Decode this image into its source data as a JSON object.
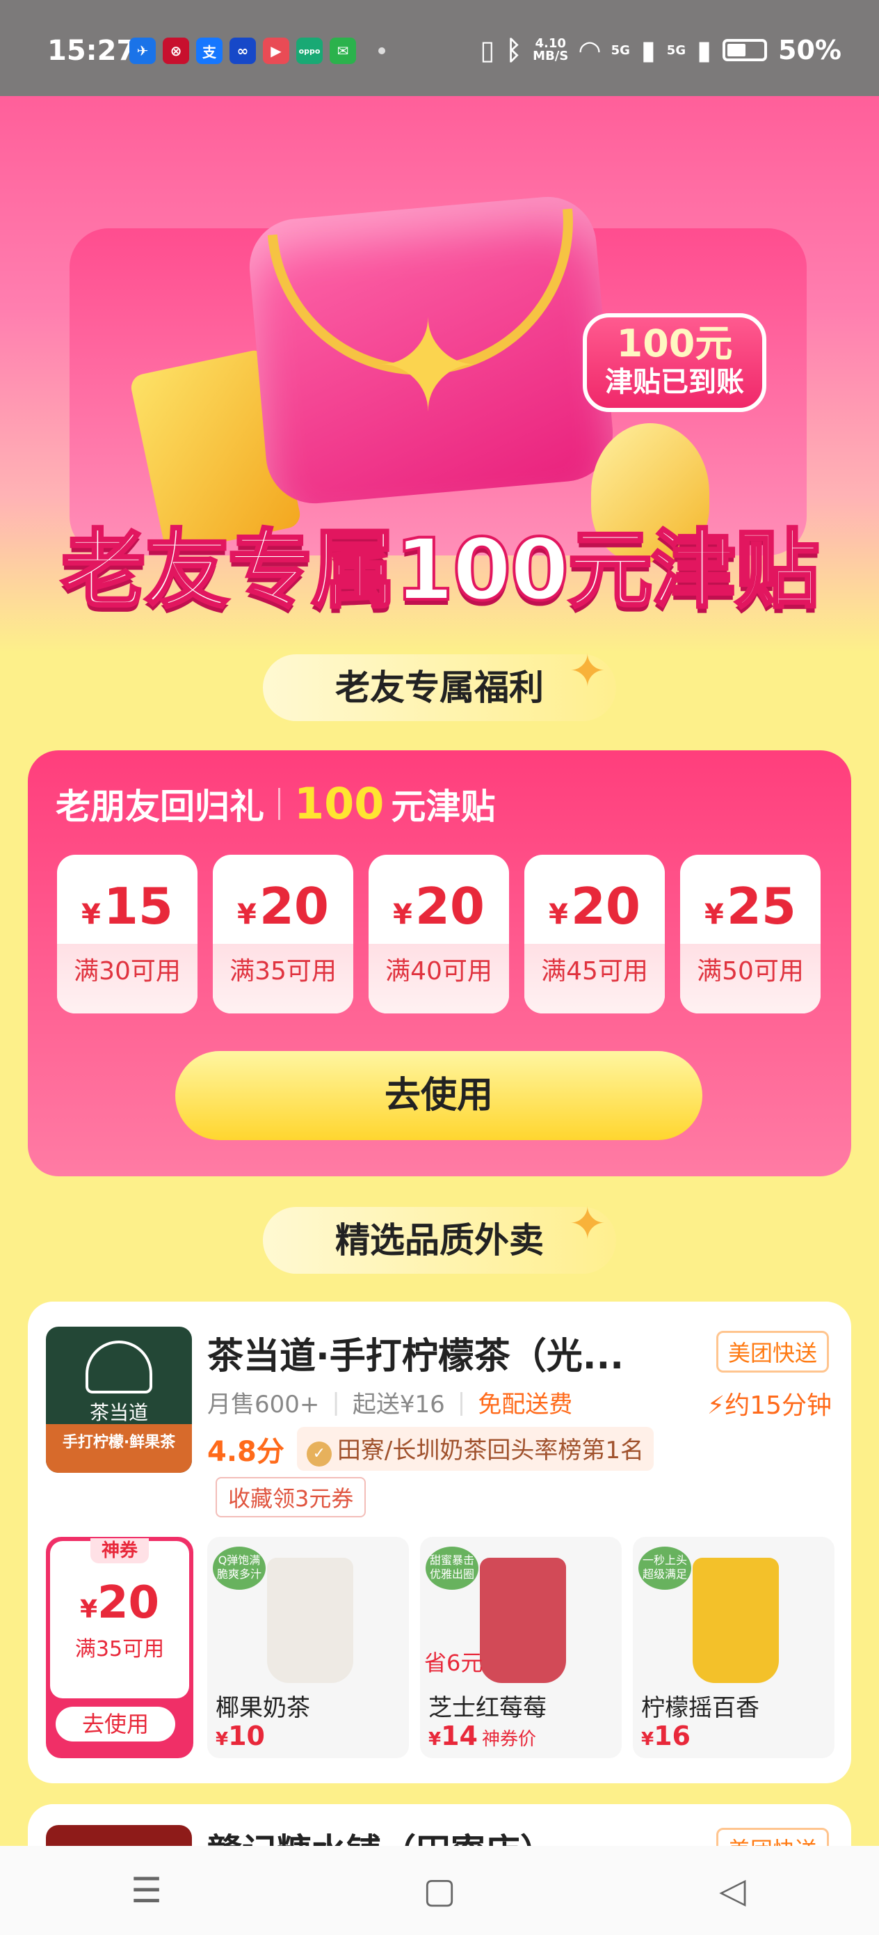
{
  "status_bar": {
    "time": "15:27",
    "apps": [
      {
        "icon": "bird-app-icon",
        "glyph": "✈",
        "color": "#1a73e8"
      },
      {
        "icon": "bank-app-icon",
        "glyph": "⊗",
        "color": "#c8102e"
      },
      {
        "icon": "alipay-icon",
        "glyph": "支",
        "color": "#1677ff"
      },
      {
        "icon": "cloud-pay-icon",
        "glyph": "∞",
        "color": "#1648c8"
      },
      {
        "icon": "video-app-icon",
        "glyph": "▶",
        "color": "#e94b55"
      },
      {
        "icon": "oppo-app-icon",
        "glyph": "oppo",
        "color": "#19a974"
      },
      {
        "icon": "message-app-icon",
        "glyph": "✉",
        "color": "#2bb24c"
      }
    ],
    "net_speed": "4.10",
    "net_unit": "MB/S",
    "signal1": "5G",
    "signal2": "5G",
    "battery": "50%"
  },
  "hero": {
    "bubble_amount": "100元",
    "bubble_text": "津贴已到账",
    "title": "老友专属100元津贴"
  },
  "section1": "老友专属福利",
  "bonus": {
    "prefix": "老朋友回归礼",
    "amount": "100",
    "suffix": "元津贴",
    "coupons": [
      {
        "value": "15",
        "cond": "满30可用"
      },
      {
        "value": "20",
        "cond": "满35可用"
      },
      {
        "value": "20",
        "cond": "满40可用"
      },
      {
        "value": "20",
        "cond": "满45可用"
      },
      {
        "value": "25",
        "cond": "满50可用"
      }
    ],
    "currency": "¥",
    "use_label": "去使用"
  },
  "section2": "精选品质外卖",
  "shop": {
    "logo_name": "茶当道",
    "logo_slogan": "手打柠檬·鲜果茶",
    "name": "茶当道·手打柠檬茶（光...",
    "delivery_tag": "美团快送",
    "monthly": "月售600+",
    "min_order": "起送¥16",
    "free_delivery": "免配送费",
    "eta": "约15分钟",
    "rating": "4.8分",
    "rank": "田寮/长圳奶茶回头率榜第1名",
    "fav": "收藏领3元券",
    "coupon": {
      "badge": "神券",
      "value": "20",
      "cond": "满35可用",
      "btn": "去使用"
    },
    "items": [
      {
        "sticker": "Q弹饱满 脆爽多汁",
        "name": "椰果奶茶",
        "price": "10",
        "save": "",
        "tag": "",
        "cup": "#eeeae4"
      },
      {
        "sticker": "甜蜜暴击 优雅出圈",
        "name": "芝士红莓莓",
        "price": "14",
        "save": "省6元",
        "tag": "神券价",
        "cup": "#d24a57"
      },
      {
        "sticker": "一秒上头 超级满足",
        "name": "柠檬摇百香",
        "price": "16",
        "save": "",
        "tag": "",
        "cup": "#f3c12a"
      }
    ]
  },
  "shop2": {
    "name": "赣记糖水铺（田寮店）",
    "delivery_tag": "美团快送"
  }
}
